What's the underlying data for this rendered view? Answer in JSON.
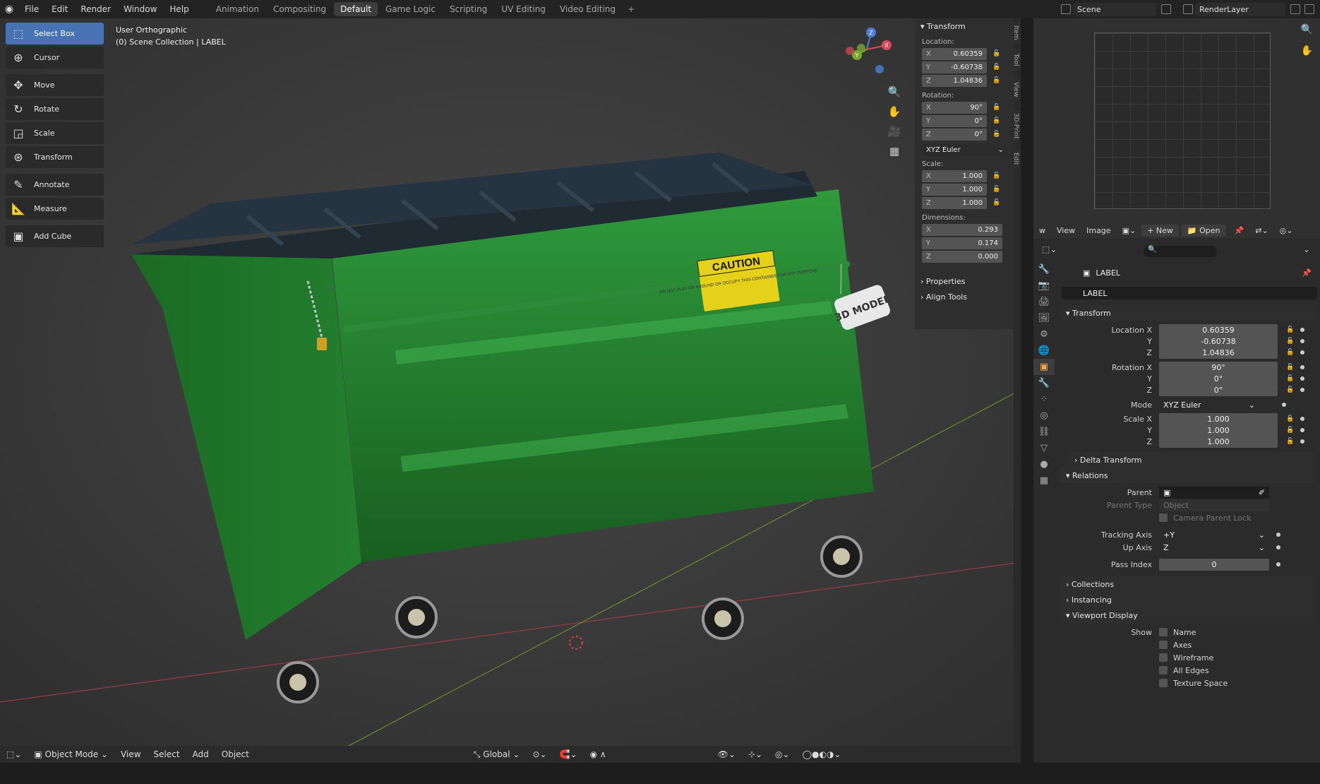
{
  "top_menu": {
    "items": [
      "File",
      "Edit",
      "Render",
      "Window",
      "Help"
    ],
    "workspaces": [
      "Animation",
      "Compositing",
      "Default",
      "Game Logic",
      "Scripting",
      "UV Editing",
      "Video Editing"
    ],
    "active_workspace": "Default",
    "scene_name": "Scene",
    "view_layer": "RenderLayer"
  },
  "viewport": {
    "view_name": "User Orthographic",
    "collection_info": "(0) Scene Collection | LABEL",
    "tools": [
      "Select Box",
      "Cursor",
      "Move",
      "Rotate",
      "Scale",
      "Transform",
      "Annotate",
      "Measure",
      "Add Cube"
    ],
    "active_tool": "Select Box",
    "caution_label": "CAUTION",
    "caution_text": "DO NOT PLAY OR AROUND OR OCCUPY THIS CONTAINER FOR ANY PURPOSE",
    "tag_text": "3D MODEL",
    "gizmo": {
      "x": "X",
      "y": "Y",
      "z": "Z"
    },
    "bottom": {
      "mode": "Object Mode",
      "menus": [
        "View",
        "Select",
        "Add",
        "Object"
      ],
      "orientation": "Global"
    }
  },
  "n_panel": {
    "transform_title": "Transform",
    "location_label": "Location:",
    "location": {
      "x": "0.60359",
      "y": "-0.60738",
      "z": "1.04836"
    },
    "rotation_label": "Rotation:",
    "rotation": {
      "x": "90°",
      "y": "0°",
      "z": "0°"
    },
    "rotation_mode": "XYZ Euler",
    "scale_label": "Scale:",
    "scale": {
      "x": "1.000",
      "y": "1.000",
      "z": "1.000"
    },
    "dimensions_label": "Dimensions:",
    "dimensions": {
      "x": "0.293",
      "y": "0.174",
      "z": "0.000"
    },
    "axis": {
      "x": "X",
      "y": "Y",
      "z": "Z"
    },
    "properties": "Properties",
    "align_tools": "Align Tools",
    "tabs": [
      "Item",
      "Tool",
      "View",
      "3D-Print",
      "Edit"
    ]
  },
  "image_editor": {
    "menu_w": "w",
    "view": "View",
    "image": "Image",
    "new": "New",
    "open": "Open"
  },
  "properties_editor": {
    "object_name": "LABEL",
    "object_datablock": "LABEL",
    "transform": "Transform",
    "location_x_label": "Location X",
    "location_x": "0.60359",
    "location_y": "-0.60738",
    "location_z": "1.04836",
    "rotation_x_label": "Rotation X",
    "rotation_x": "90°",
    "rotation_y": "0°",
    "rotation_z": "0°",
    "mode_label": "Mode",
    "mode_value": "XYZ Euler",
    "scale_x_label": "Scale X",
    "scale_x": "1.000",
    "scale_y": "1.000",
    "scale_z": "1.000",
    "y_label": "Y",
    "z_label": "Z",
    "delta_transform": "Delta Transform",
    "relations": "Relations",
    "parent_label": "Parent",
    "parent_type_label": "Parent Type",
    "parent_type_value": "Object",
    "camera_parent_lock": "Camera Parent Lock",
    "tracking_axis_label": "Tracking Axis",
    "tracking_axis_value": "+Y",
    "up_axis_label": "Up Axis",
    "up_axis_value": "Z",
    "pass_index_label": "Pass Index",
    "pass_index_value": "0",
    "collections": "Collections",
    "instancing": "Instancing",
    "viewport_display": "Viewport Display",
    "show_label": "Show",
    "show_name": "Name",
    "show_axes": "Axes",
    "show_wireframe": "Wireframe",
    "show_all_edges": "All Edges",
    "texture_space": "Texture Space"
  }
}
